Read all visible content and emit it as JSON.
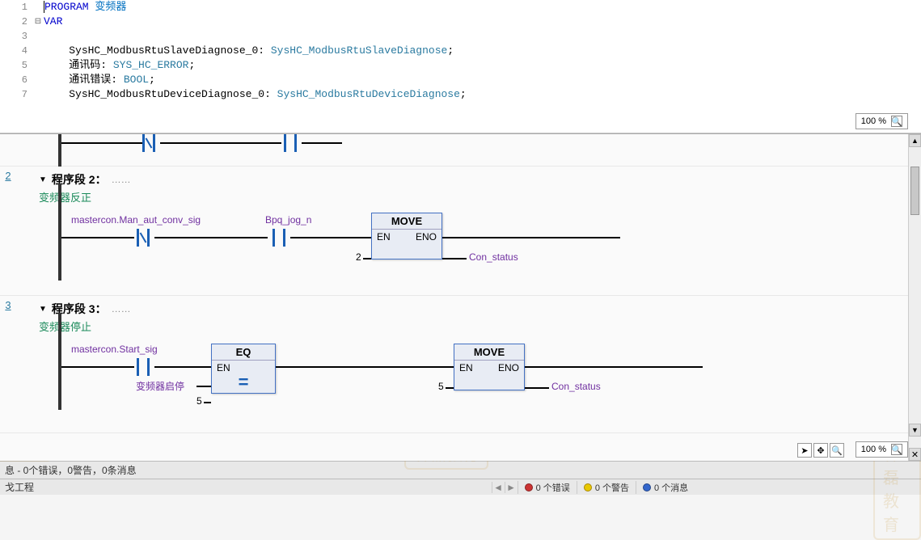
{
  "watermark": "林磊教育",
  "code": {
    "lines": [
      {
        "n": 1,
        "fold": "",
        "html": "<span class='caret'></span><span class='kw-prog'>PROGRAM</span> <span class='cn-name'>变频器</span>"
      },
      {
        "n": 2,
        "fold": "⊟",
        "html": "<span class='kw-var'>VAR</span>"
      },
      {
        "n": 3,
        "fold": "",
        "html": ""
      },
      {
        "n": 4,
        "fold": "",
        "html": "    <span class='ident'>SysHC_ModbusRtuSlaveDiagnose_0</span>: <span class='type'>SysHC_ModbusRtuSlaveDiagnose</span>;"
      },
      {
        "n": 5,
        "fold": "",
        "html": "    <span class='ident'>通讯码</span>: <span class='type'>SYS_HC_ERROR</span>;"
      },
      {
        "n": 6,
        "fold": "",
        "html": "    <span class='ident'>通讯错误</span>: <span class='type'>BOOL</span>;"
      },
      {
        "n": 7,
        "fold": "",
        "html": "    <span class='ident'>SysHC_ModbusRtuDeviceDiagnose_0</span>: <span class='type'>SysHC_ModbusRtuDeviceDiagnose</span>;"
      }
    ],
    "zoom": "100 %"
  },
  "networks": {
    "net2": {
      "num": "2",
      "title": "程序段 2：",
      "subtitle": "变频器反正",
      "var1": "mastercon.Man_aut_conv_sig",
      "var2": "Bpq_jog_n",
      "block": {
        "title": "MOVE",
        "en": "EN",
        "eno": "ENO"
      },
      "in_val": "2",
      "out_var": "Con_status"
    },
    "net3": {
      "num": "3",
      "title": "程序段 3：",
      "subtitle": "变频器停止",
      "var1": "mastercon.Start_sig",
      "var2": "变频器启停",
      "block1": {
        "title": "EQ",
        "en": "EN"
      },
      "block2": {
        "title": "MOVE",
        "en": "EN",
        "eno": "ENO"
      },
      "in_val": "5",
      "mid_val": "5",
      "out_var": "Con_status"
    },
    "zoom": "100 %"
  },
  "status": {
    "text": "息 - 0个错误，0警告，0条消息"
  },
  "tabs": {
    "left": "戈工程",
    "err": "0 个错误",
    "warn": "0 个警告",
    "msg": "0 个消息"
  }
}
